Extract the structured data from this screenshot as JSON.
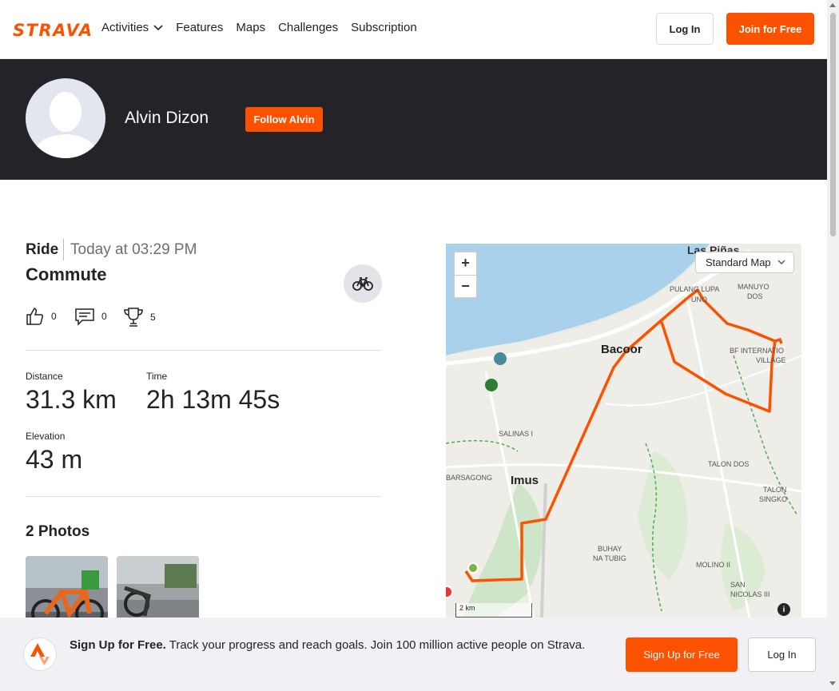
{
  "brand": {
    "logo_text": "STRAVA",
    "accent_color": "#fc5200"
  },
  "nav": {
    "links": [
      {
        "label": "Activities",
        "has_dropdown": true
      },
      {
        "label": "Features"
      },
      {
        "label": "Maps"
      },
      {
        "label": "Challenges"
      },
      {
        "label": "Subscription"
      }
    ],
    "login_label": "Log In",
    "join_label": "Join for Free"
  },
  "athlete": {
    "name": "Alvin Dizon",
    "follow_label": "Follow Alvin"
  },
  "activity": {
    "type": "Ride",
    "time": "Today at 03:29 PM",
    "title": "Commute",
    "sport_icon": "bike-icon",
    "kudos_count": "0",
    "comments_count": "0",
    "achievements_count": "5",
    "stats": {
      "distance_label": "Distance",
      "distance_value": "31.3 km",
      "time_label": "Time",
      "time_value": "2h 13m 45s",
      "elevation_label": "Elevation",
      "elevation_value": "43 m"
    }
  },
  "photos": {
    "title": "2 Photos",
    "items": [
      {
        "name": "photo-bike-orange"
      },
      {
        "name": "photo-street-rain"
      }
    ]
  },
  "map": {
    "zoom_in": "+",
    "zoom_out": "−",
    "style_select": "Standard Map",
    "scale_label": "2 km",
    "info_label": "i",
    "places": [
      "Las Piñas",
      "PULANG LUPA UNO",
      "MANUYO DOS",
      "Bacoor",
      "BF INTERNATIONAL VILLAGE",
      "SALINAS I",
      "Imus",
      "BAYAN BARSAGONG",
      "TALON DOS",
      "TALON SINGKO",
      "BUHAY NA TUBIG",
      "MOLINO II",
      "SAN NICOLAS III"
    ]
  },
  "banner": {
    "headline": "Sign Up for Free.",
    "text": " Track your progress and reach goals. Join 100 million active people on Strava.",
    "signup_label": "Sign Up for Free",
    "login_label": "Log In"
  }
}
